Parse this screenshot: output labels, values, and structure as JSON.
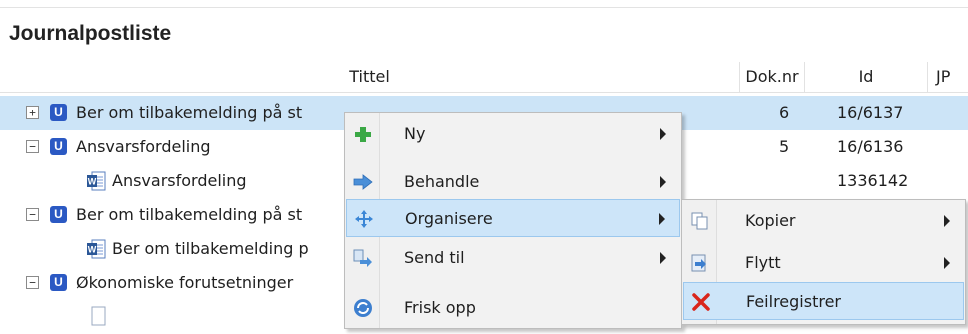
{
  "page": {
    "title": "Journalpostliste"
  },
  "table": {
    "columns": [
      "Tittel",
      "Dok.nr",
      "Id",
      "JP"
    ],
    "rows": [
      {
        "expander": "+",
        "icon": "U",
        "title": "Ber om tilbakemelding på st",
        "doknr": "6",
        "id": "16/6137",
        "selected": true
      },
      {
        "expander": "−",
        "icon": "U",
        "title": "Ansvarsfordeling",
        "doknr": "5",
        "id": "16/6136"
      },
      {
        "icon": "word-document-icon",
        "title": "Ansvarsfordeling",
        "doknr": "",
        "id": "1336142"
      },
      {
        "expander": "−",
        "icon": "U",
        "title": "Ber om tilbakemelding på st",
        "doknr": "",
        "id": ""
      },
      {
        "icon": "word-document-icon",
        "title": "Ber om tilbakemelding p",
        "doknr": "",
        "id": ""
      },
      {
        "expander": "−",
        "icon": "U",
        "title": "Økonomiske forutsetninger",
        "doknr": "",
        "id": ""
      }
    ]
  },
  "context_menu": {
    "items": [
      {
        "label": "Ny",
        "icon": "plus-icon",
        "submenu": true
      },
      {
        "label": "Behandle",
        "icon": "arrow-right-icon",
        "submenu": true
      },
      {
        "label": "Organisere",
        "icon": "move-arrows-icon",
        "submenu": true,
        "highlighted": true
      },
      {
        "label": "Send til",
        "icon": "send-to-icon",
        "submenu": true
      },
      {
        "label": "Frisk opp",
        "icon": "refresh-icon",
        "submenu": false
      }
    ]
  },
  "submenu": {
    "items": [
      {
        "label": "Kopier",
        "icon": "copy-icon",
        "submenu": true
      },
      {
        "label": "Flytt",
        "icon": "move-icon",
        "submenu": true
      },
      {
        "label": "Feilregistrer",
        "icon": "red-x-icon",
        "submenu": false,
        "highlighted": true
      }
    ]
  },
  "colors": {
    "selection": "#cce4f7",
    "menu_highlight": "#cde5f9",
    "badge": "#2b59c3",
    "error_x": "#d9261c"
  }
}
